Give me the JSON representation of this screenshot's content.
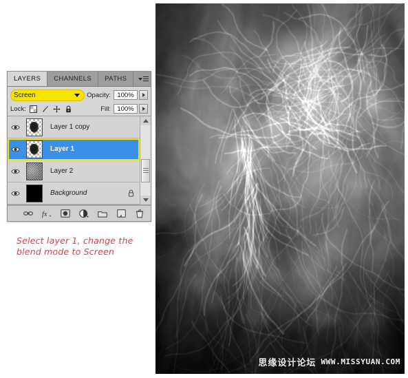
{
  "panel": {
    "tabs": [
      {
        "label": "LAYERS",
        "active": true
      },
      {
        "label": "CHANNELS",
        "active": false
      },
      {
        "label": "PATHS",
        "active": false
      }
    ],
    "menu_icon": "panel-menu-icon",
    "blend_mode": {
      "value": "Screen",
      "highlight_color": "#f5e400",
      "caret_icon": "chevron-down-icon"
    },
    "opacity": {
      "label": "Opacity:",
      "value": "100%"
    },
    "fill": {
      "label": "Fill:",
      "value": "100%"
    },
    "lock": {
      "label": "Lock:",
      "icons": [
        "lock-transparency-icon",
        "lock-image-brush-icon",
        "lock-position-move-icon",
        "lock-all-padlock-icon"
      ]
    },
    "layers": [
      {
        "name": "Layer 1 copy",
        "visible": true,
        "thumb": "blob-on-transparency",
        "selected": false,
        "highlighted": false,
        "locked": false,
        "italic": false
      },
      {
        "name": "Layer 1",
        "visible": true,
        "thumb": "blob-on-transparency",
        "selected": true,
        "highlighted": true,
        "locked": false,
        "italic": false
      },
      {
        "name": "Layer 2",
        "visible": true,
        "thumb": "noise-clouds",
        "selected": false,
        "highlighted": false,
        "locked": false,
        "italic": false
      },
      {
        "name": "Background",
        "visible": true,
        "thumb": "solid-black",
        "selected": false,
        "highlighted": false,
        "locked": true,
        "italic": true
      }
    ],
    "scrollbar": {
      "up_icon": "scroll-up-arrow-icon",
      "down_icon": "scroll-down-arrow-icon"
    },
    "bottom_toolbar": [
      "link-layers-icon",
      "layer-style-fx-icon",
      "add-layer-mask-icon",
      "adjustment-layer-icon",
      "new-group-folder-icon",
      "new-layer-icon",
      "delete-layer-trash-icon"
    ],
    "selected_layer_highlight_color": "#3a8fe8"
  },
  "caption": {
    "line1": "Select layer 1, change the",
    "line2": "blend mode to Screen",
    "color": "#e03b48"
  },
  "photo": {
    "description": "grayscale smoke forming a face profile over cloud texture",
    "watermark_cn": "思缘设计论坛",
    "watermark_en": "WWW.MISSYUAN.COM"
  }
}
